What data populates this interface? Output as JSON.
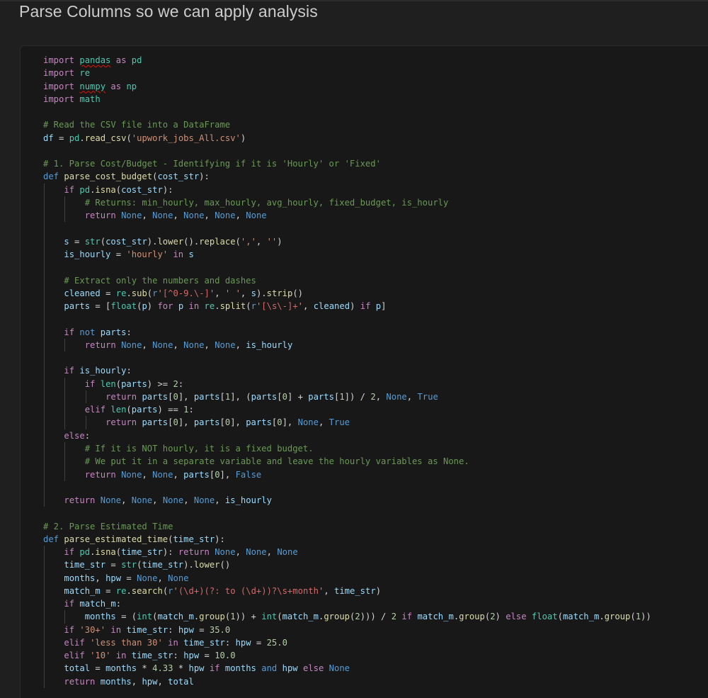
{
  "header": {
    "title": "Parse Columns so we can apply analysis"
  },
  "code": {
    "language": "python",
    "diagnostics": [
      "pandas",
      "numpy"
    ],
    "lines": [
      "import pandas as pd",
      "import re",
      "import numpy as np",
      "import math",
      "",
      "# Read the CSV file into a DataFrame",
      "df = pd.read_csv('upwork_jobs_All.csv')",
      "",
      "# 1. Parse Cost/Budget - Identifying if it is 'Hourly' or 'Fixed'",
      "def parse_cost_budget(cost_str):",
      "    if pd.isna(cost_str):",
      "        # Returns: min_hourly, max_hourly, avg_hourly, fixed_budget, is_hourly",
      "        return None, None, None, None, None",
      "",
      "    s = str(cost_str).lower().replace(',', '')",
      "    is_hourly = 'hourly' in s",
      "",
      "    # Extract only the numbers and dashes",
      "    cleaned = re.sub(r'[^0-9.\\-]', ' ', s).strip()",
      "    parts = [float(p) for p in re.split(r'[\\s\\-]+', cleaned) if p]",
      "",
      "    if not parts:",
      "        return None, None, None, None, is_hourly",
      "",
      "    if is_hourly:",
      "        if len(parts) >= 2:",
      "            return parts[0], parts[1], (parts[0] + parts[1]) / 2, None, True",
      "        elif len(parts) == 1:",
      "            return parts[0], parts[0], parts[0], None, True",
      "    else:",
      "        # If it is NOT hourly, it is a fixed budget.",
      "        # We put it in a separate variable and leave the hourly variables as None.",
      "        return None, None, parts[0], False",
      "",
      "    return None, None, None, None, is_hourly",
      "",
      "# 2. Parse Estimated Time",
      "def parse_estimated_time(time_str):",
      "    if pd.isna(time_str): return None, None, None",
      "    time_str = str(time_str).lower()",
      "    months, hpw = None, None",
      "    match_m = re.search(r'(\\d+)(?: to (\\d+))?\\s+month', time_str)",
      "    if match_m:",
      "        months = (int(match_m.group(1)) + int(match_m.group(2))) / 2 if match_m.group(2) else float(match_m.group(1))",
      "    if '30+' in time_str: hpw = 35.0",
      "    elif 'less than 30' in time_str: hpw = 25.0",
      "    elif '10' in time_str: hpw = 10.0",
      "    total = months * 4.33 * hpw if months and hpw else None",
      "    return months, hpw, total"
    ]
  },
  "colors": {
    "background": "#1f1f1f",
    "cell_background": "#181818",
    "keyword": "#c586c0",
    "builtin_keyword": "#569cd6",
    "function": "#dcdcaa",
    "variable": "#9cdcfe",
    "module": "#4ec9b0",
    "string": "#ce9178",
    "regex": "#d16969",
    "number": "#b5cea8",
    "comment": "#6a9955"
  }
}
